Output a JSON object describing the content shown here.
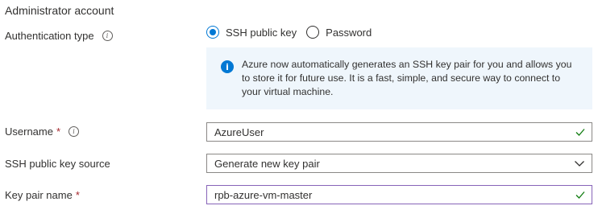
{
  "section": {
    "title": "Administrator account"
  },
  "auth": {
    "label": "Authentication type",
    "options": [
      {
        "label": "SSH public key",
        "selected": true
      },
      {
        "label": "Password",
        "selected": false
      }
    ],
    "info_text": "Azure now automatically generates an SSH key pair for you and allows you to store it for future use. It is a fast, simple, and secure way to connect to your virtual machine."
  },
  "username": {
    "label": "Username",
    "required": "*",
    "value": "AzureUser"
  },
  "key_source": {
    "label": "SSH public key source",
    "value": "Generate new key pair"
  },
  "key_pair_name": {
    "label": "Key pair name",
    "required": "*",
    "value": "rpb-azure-vm-master"
  },
  "colors": {
    "accent": "#0078d4",
    "required": "#a4262c",
    "valid": "#107c10",
    "focus_border": "#8764b8",
    "info_bg": "#eff6fc"
  }
}
